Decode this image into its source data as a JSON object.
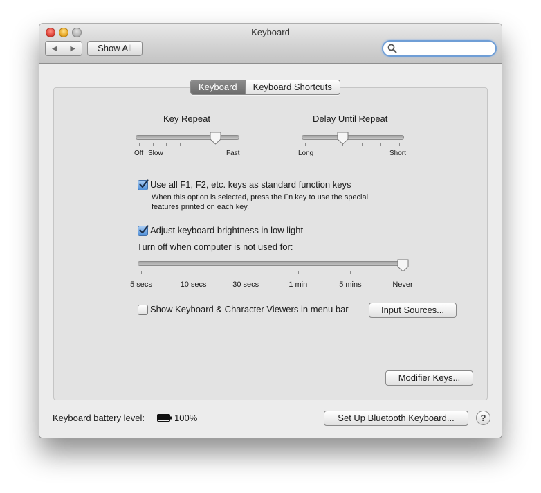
{
  "window": {
    "title": "Keyboard",
    "nav": {
      "back_icon": "◀",
      "forward_icon": "▶"
    },
    "show_all_label": "Show All",
    "search": {
      "value": "",
      "placeholder": ""
    }
  },
  "tabs": [
    {
      "label": "Keyboard",
      "selected": true
    },
    {
      "label": "Keyboard Shortcuts",
      "selected": false
    }
  ],
  "key_repeat": {
    "title": "Key Repeat",
    "labels": [
      "Off",
      "Slow",
      "Fast"
    ],
    "ticks": 8,
    "position": 0.8
  },
  "delay_until_repeat": {
    "title": "Delay Until Repeat",
    "labels": [
      "Long",
      "Short"
    ],
    "ticks": 6,
    "position": 0.4
  },
  "function_keys": {
    "checked": true,
    "label": "Use all F1, F2, etc. keys as standard function keys",
    "hint_line1": "When this option is selected, press the Fn key to use the special",
    "hint_line2": "features printed on each key."
  },
  "brightness": {
    "checked": true,
    "label": "Adjust keyboard brightness in low light"
  },
  "turn_off": {
    "label": "Turn off when computer is not used for:",
    "ticks": [
      "5 secs",
      "10 secs",
      "30 secs",
      "1 min",
      "5 mins",
      "Never"
    ],
    "selected": "Never"
  },
  "viewers": {
    "checked": false,
    "label": "Show Keyboard & Character Viewers in menu bar"
  },
  "buttons": {
    "input_sources": "Input Sources...",
    "modifier_keys": "Modifier Keys...",
    "bluetooth": "Set Up Bluetooth Keyboard...",
    "help": "?"
  },
  "battery": {
    "label": "Keyboard battery level:",
    "value": "100%"
  },
  "colors": {
    "accent": "#4f8fd8",
    "window_bg": "#ececec",
    "panel_bg": "#e3e3e3"
  }
}
